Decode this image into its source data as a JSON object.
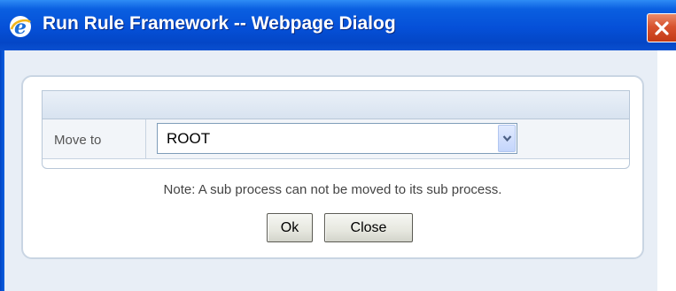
{
  "window": {
    "title": "Run Rule Framework -- Webpage Dialog",
    "icon": "ie-icon",
    "close_icon": "close-icon"
  },
  "form": {
    "move_to_label": "Move to",
    "move_to_value": "ROOT",
    "dropdown_icon": "chevron-down-icon"
  },
  "note": "Note: A sub process can not be moved to its sub process.",
  "buttons": {
    "ok": "Ok",
    "close": "Close"
  },
  "colors": {
    "titlebar": "#0550d8",
    "close_button": "#d8532f",
    "background": "#e8eef6"
  }
}
